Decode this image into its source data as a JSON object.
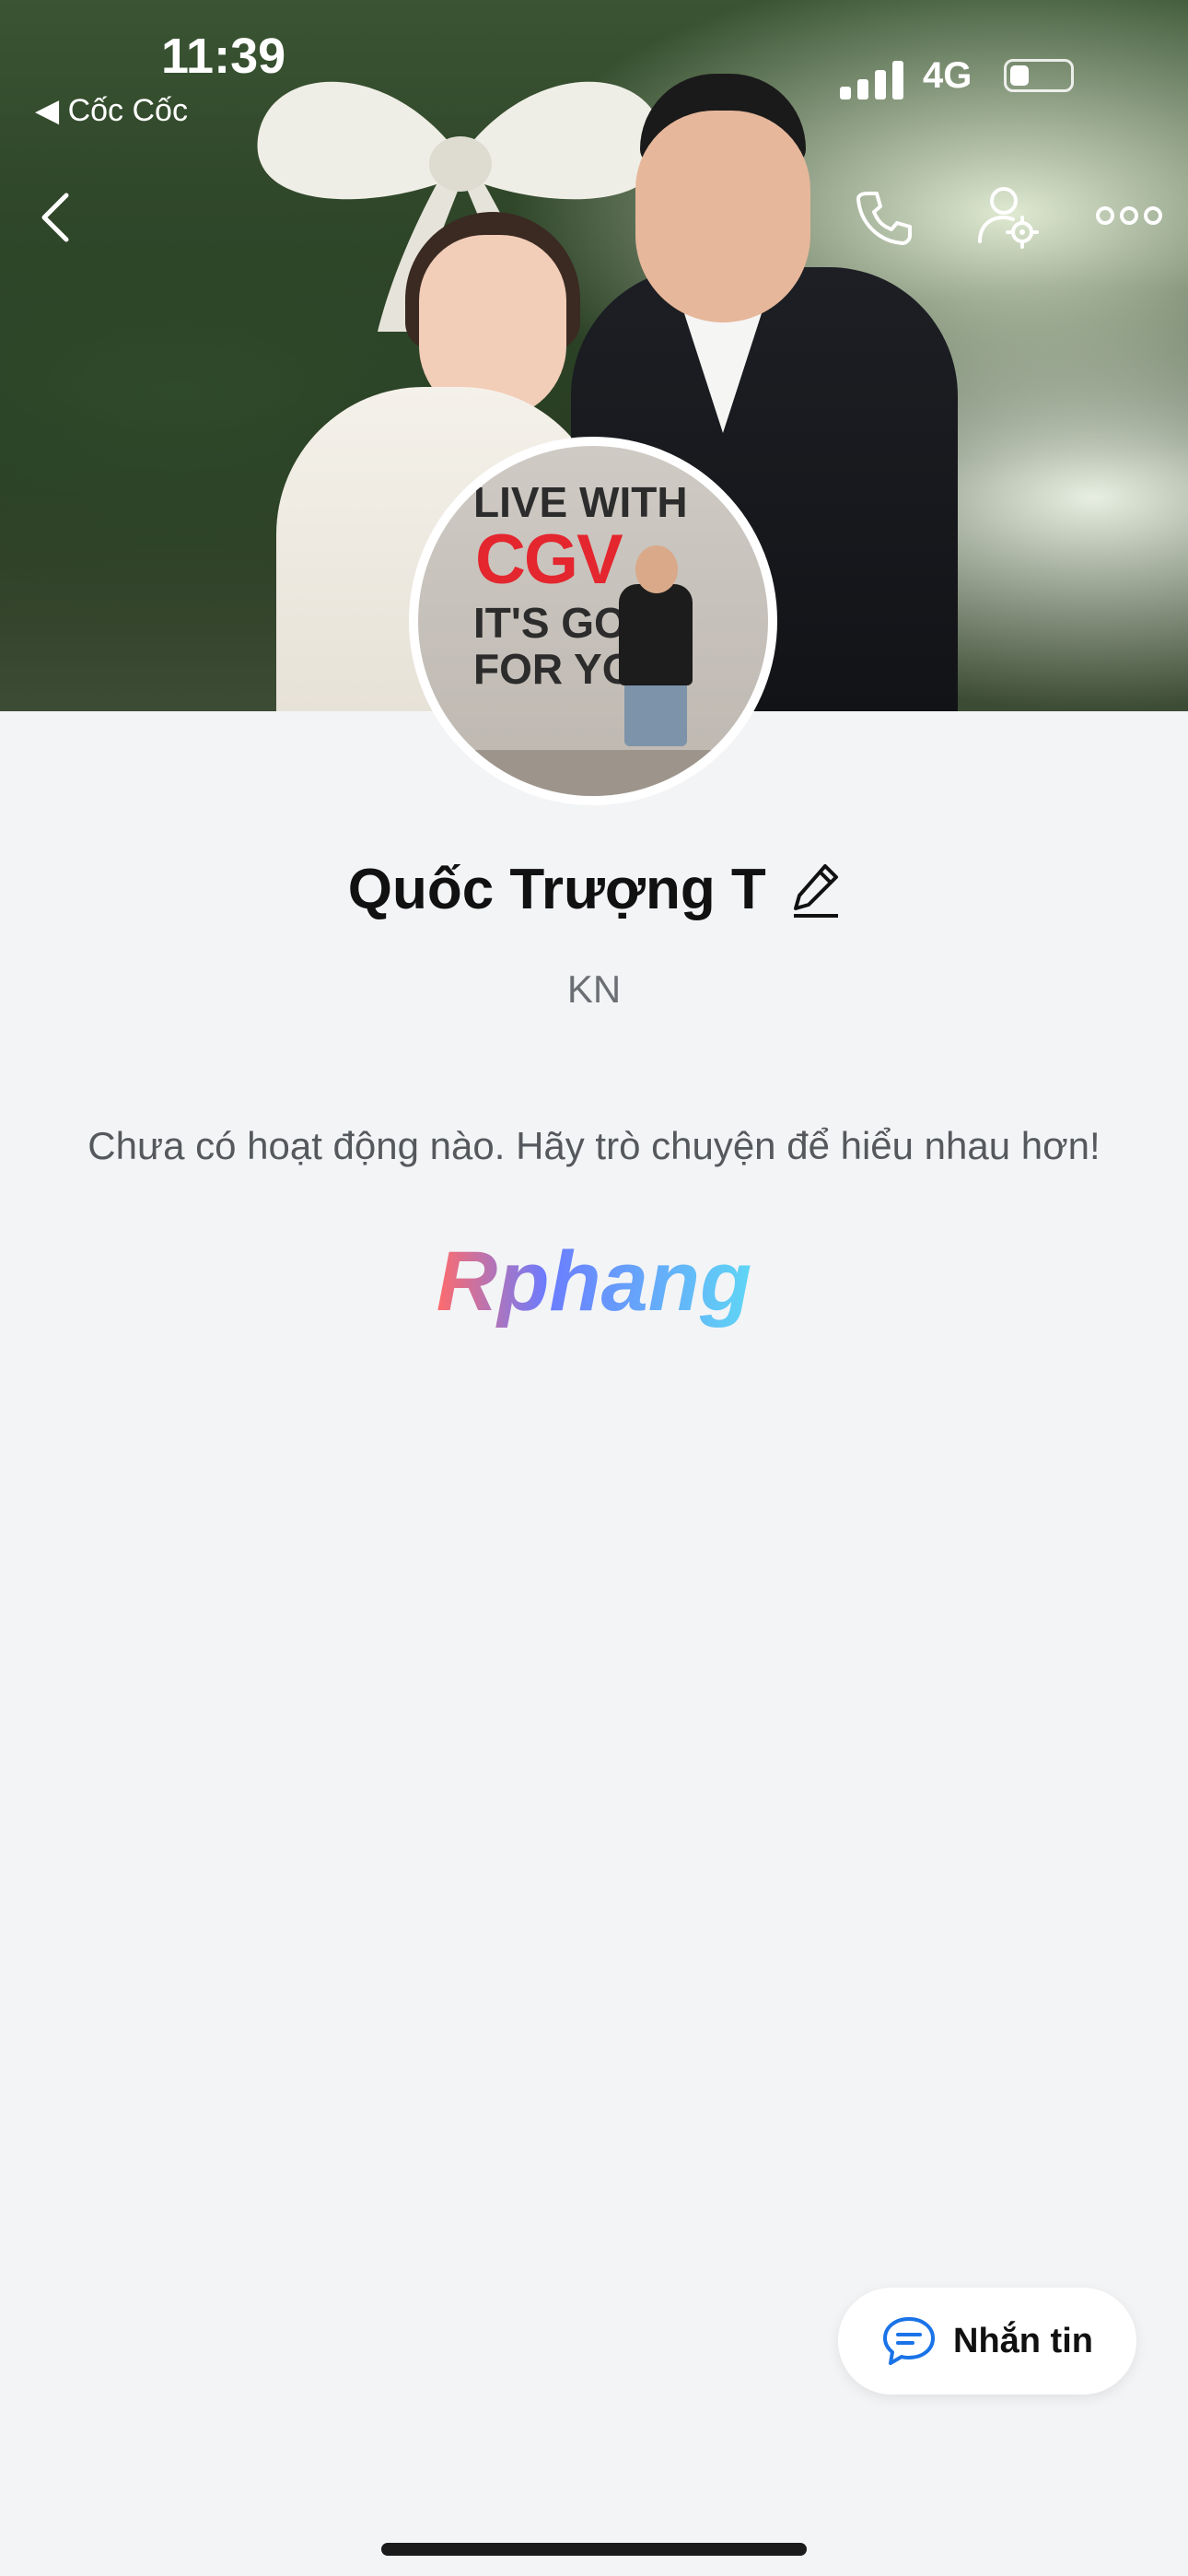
{
  "status_bar": {
    "time": "11:39",
    "back_app": "◀ Cốc Cốc",
    "network": "4G"
  },
  "cover": {
    "icons": [
      "back-arrow-icon",
      "phone-icon",
      "profile-settings-icon",
      "more-icon"
    ]
  },
  "avatar": {
    "line1": "LIVE WITH",
    "brand": "CGV",
    "line3": "IT'S GOO",
    "line4": "FOR YO"
  },
  "profile": {
    "name": "Quốc Trượng T",
    "subtitle": "KN",
    "empty_message": "Chưa có hoạt động nào. Hãy trò chuyện để hiểu nhau hơn!"
  },
  "watermark": {
    "text": "Rphang"
  },
  "actions": {
    "message_label": "Nhắn tin"
  },
  "colors": {
    "background": "#f3f4f6",
    "accent_blue": "#1a73e8",
    "brand_red": "#e4262e"
  }
}
